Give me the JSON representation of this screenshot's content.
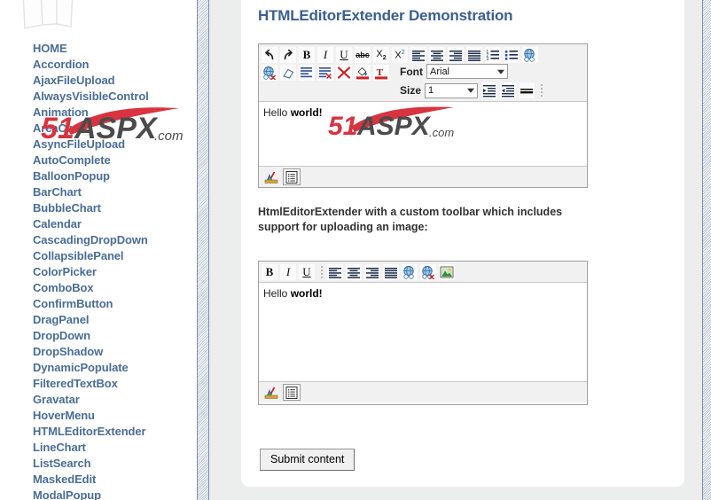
{
  "sidebar": {
    "logo_name": "pages-logo",
    "items": [
      {
        "label": "HOME",
        "name": "home"
      },
      {
        "label": "Accordion",
        "name": "accordion"
      },
      {
        "label": "AjaxFileUpload",
        "name": "ajaxfileupload"
      },
      {
        "label": "AlwaysVisibleControl",
        "name": "alwaysvisiblecontrol"
      },
      {
        "label": "Animation",
        "name": "animation"
      },
      {
        "label": "AreaChart",
        "name": "areachart"
      },
      {
        "label": "AsyncFileUpload",
        "name": "asyncfileupload"
      },
      {
        "label": "AutoComplete",
        "name": "autocomplete"
      },
      {
        "label": "BalloonPopup",
        "name": "balloonpopup"
      },
      {
        "label": "BarChart",
        "name": "barchart"
      },
      {
        "label": "BubbleChart",
        "name": "bubblechart"
      },
      {
        "label": "Calendar",
        "name": "calendar"
      },
      {
        "label": "CascadingDropDown",
        "name": "cascadingdropdown"
      },
      {
        "label": "CollapsiblePanel",
        "name": "collapsiblepanel"
      },
      {
        "label": "ColorPicker",
        "name": "colorpicker"
      },
      {
        "label": "ComboBox",
        "name": "combobox"
      },
      {
        "label": "ConfirmButton",
        "name": "confirmbutton"
      },
      {
        "label": "DragPanel",
        "name": "dragpanel"
      },
      {
        "label": "DropDown",
        "name": "dropdown"
      },
      {
        "label": "DropShadow",
        "name": "dropshadow"
      },
      {
        "label": "DynamicPopulate",
        "name": "dynamicpopulate"
      },
      {
        "label": "FilteredTextBox",
        "name": "filteredtextbox"
      },
      {
        "label": "Gravatar",
        "name": "gravatar"
      },
      {
        "label": "HoverMenu",
        "name": "hovermenu"
      },
      {
        "label": "HTMLEditorExtender",
        "name": "htmleditorextender"
      },
      {
        "label": "LineChart",
        "name": "linechart"
      },
      {
        "label": "ListSearch",
        "name": "listsearch"
      },
      {
        "label": "MaskedEdit",
        "name": "maskededit"
      },
      {
        "label": "ModalPopup",
        "name": "modalpopup"
      }
    ]
  },
  "watermark": {
    "digits": "51",
    "word": "ASPX",
    "suffix": ".com",
    "red": "#d8333f",
    "dark": "#4b4b4b"
  },
  "main": {
    "page_title": "HTMLEditorExtender Demonstration",
    "caption2": "HtmlEditorExtender with a custom toolbar which includes support for uploading an image:",
    "submit_label": "Submit content"
  },
  "editor1": {
    "content_plain": "Hello ",
    "content_bold": "world!",
    "font_label": "Font",
    "font_value": "Arial",
    "size_label": "Size",
    "size_value": "1",
    "toolbar_row1": [
      {
        "name": "undo-icon",
        "title": "Undo"
      },
      {
        "name": "redo-icon",
        "title": "Redo"
      },
      {
        "name": "bold-icon",
        "title": "Bold"
      },
      {
        "name": "italic-icon",
        "title": "Italic"
      },
      {
        "name": "underline-icon",
        "title": "Underline"
      },
      {
        "name": "strikethrough-icon",
        "title": "Strike through"
      },
      {
        "name": "subscript-icon",
        "title": "Subscript"
      },
      {
        "name": "superscript-icon",
        "title": "Superscript"
      },
      {
        "name": "align-left-icon",
        "title": "Align left"
      },
      {
        "name": "align-center-icon",
        "title": "Align center"
      },
      {
        "name": "align-right-icon",
        "title": "Align right"
      },
      {
        "name": "justify-icon",
        "title": "Justify"
      },
      {
        "name": "ordered-list-icon",
        "title": "Numbered list"
      },
      {
        "name": "unordered-list-icon",
        "title": "Bulleted list"
      },
      {
        "name": "insert-link-icon",
        "title": "Insert link"
      }
    ],
    "toolbar_row2": [
      {
        "name": "remove-link-icon",
        "title": "Remove link"
      },
      {
        "name": "eraser-icon",
        "title": "Clear formatting"
      },
      {
        "name": "paragraph-indent-icon",
        "title": "Paragraph"
      },
      {
        "name": "remove-format-icon",
        "title": "Remove format"
      },
      {
        "name": "delete-icon",
        "title": "Delete"
      },
      {
        "name": "background-color-icon",
        "title": "Background color"
      },
      {
        "name": "foreground-color-icon",
        "title": "Text color"
      }
    ],
    "toolbar_row2_tail": [
      {
        "name": "indent-icon",
        "title": "Indent"
      },
      {
        "name": "outdent-icon",
        "title": "Outdent"
      },
      {
        "name": "horizontal-rule-icon",
        "title": "Horizontal rule"
      }
    ],
    "status_tabs": [
      {
        "name": "design-view-tab",
        "title": "Design"
      },
      {
        "name": "html-source-view-tab",
        "title": "HTML"
      }
    ]
  },
  "editor2": {
    "content_plain": "Hello ",
    "content_bold": "world!",
    "toolbar": [
      {
        "name": "bold-icon",
        "title": "Bold"
      },
      {
        "name": "italic-icon",
        "title": "Italic"
      },
      {
        "name": "underline-icon",
        "title": "Underline"
      },
      {
        "name": "align-left-icon",
        "title": "Align left"
      },
      {
        "name": "align-center-icon",
        "title": "Align center"
      },
      {
        "name": "align-right-icon",
        "title": "Align right"
      },
      {
        "name": "justify-icon",
        "title": "Justify"
      },
      {
        "name": "insert-link-icon",
        "title": "Insert link"
      },
      {
        "name": "remove-link-icon",
        "title": "Remove link"
      },
      {
        "name": "insert-image-icon",
        "title": "Insert image"
      }
    ],
    "status_tabs": [
      {
        "name": "design-view-tab",
        "title": "Design"
      },
      {
        "name": "html-source-view-tab",
        "title": "HTML"
      }
    ]
  },
  "colors": {
    "link_blue": "#4a6d96",
    "title_blue": "#3b5f8f",
    "toolbar_bg": "#f1f1f1",
    "page_bg": "#eceded"
  }
}
